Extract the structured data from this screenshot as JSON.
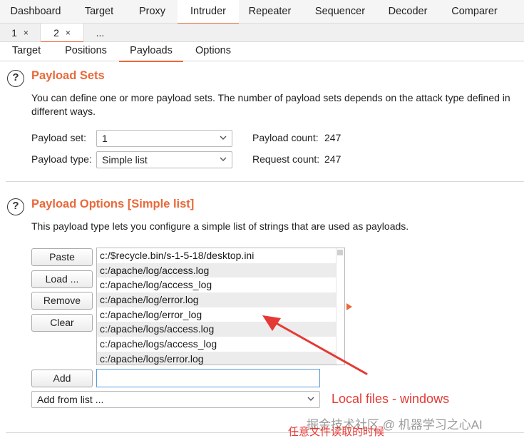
{
  "top_tabs": [
    "Dashboard",
    "Target",
    "Proxy",
    "Intruder",
    "Repeater",
    "Sequencer",
    "Decoder",
    "Comparer"
  ],
  "attack_tabs": [
    {
      "label": "1",
      "close": "×"
    },
    {
      "label": "2",
      "close": "×"
    },
    {
      "label": "..."
    }
  ],
  "inner_tabs": [
    "Target",
    "Positions",
    "Payloads",
    "Options"
  ],
  "payload_sets": {
    "help": "?",
    "title": "Payload Sets",
    "description": "You can define one or more payload sets. The number of payload sets depends on the attack type defined in different ways.",
    "payload_set_label": "Payload set:",
    "payload_set_value": "1",
    "payload_type_label": "Payload type:",
    "payload_type_value": "Simple list",
    "payload_count_label": "Payload count:",
    "payload_count_value": "247",
    "request_count_label": "Request count:",
    "request_count_value": "247"
  },
  "payload_options": {
    "help": "?",
    "title": "Payload Options [Simple list]",
    "description": "This payload type lets you configure a simple list of strings that are used as payloads.",
    "buttons": {
      "paste": "Paste",
      "load": "Load ...",
      "remove": "Remove",
      "clear": "Clear",
      "add": "Add"
    },
    "items": [
      "c:/$recycle.bin/s-1-5-18/desktop.ini",
      "c:/apache/log/access.log",
      "c:/apache/log/access_log",
      "c:/apache/log/error.log",
      "c:/apache/log/error_log",
      "c:/apache/logs/access.log",
      "c:/apache/logs/access_log",
      "c:/apache/logs/error.log"
    ],
    "add_input_value": "",
    "add_from_list_label": "Add from list ..."
  },
  "annotations": {
    "local_files": "Local files - windows",
    "watermark": "掘金技术社区 @ 机器学习之心AI",
    "chinese_note": "任意文件读取的时候"
  },
  "colors": {
    "accent": "#e8693a",
    "annotation": "#e53935",
    "focus": "#5b9bd5"
  }
}
